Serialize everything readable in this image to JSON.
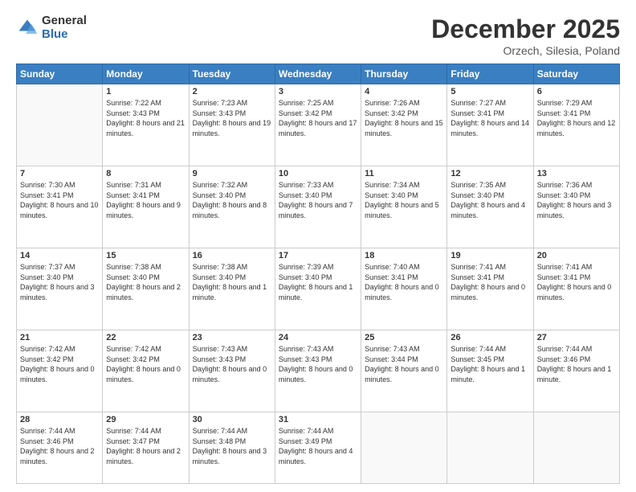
{
  "logo": {
    "general": "General",
    "blue": "Blue"
  },
  "header": {
    "month": "December 2025",
    "location": "Orzech, Silesia, Poland"
  },
  "weekdays": [
    "Sunday",
    "Monday",
    "Tuesday",
    "Wednesday",
    "Thursday",
    "Friday",
    "Saturday"
  ],
  "weeks": [
    [
      {
        "day": "",
        "sunrise": "",
        "sunset": "",
        "daylight": ""
      },
      {
        "day": "1",
        "sunrise": "Sunrise: 7:22 AM",
        "sunset": "Sunset: 3:43 PM",
        "daylight": "Daylight: 8 hours and 21 minutes."
      },
      {
        "day": "2",
        "sunrise": "Sunrise: 7:23 AM",
        "sunset": "Sunset: 3:43 PM",
        "daylight": "Daylight: 8 hours and 19 minutes."
      },
      {
        "day": "3",
        "sunrise": "Sunrise: 7:25 AM",
        "sunset": "Sunset: 3:42 PM",
        "daylight": "Daylight: 8 hours and 17 minutes."
      },
      {
        "day": "4",
        "sunrise": "Sunrise: 7:26 AM",
        "sunset": "Sunset: 3:42 PM",
        "daylight": "Daylight: 8 hours and 15 minutes."
      },
      {
        "day": "5",
        "sunrise": "Sunrise: 7:27 AM",
        "sunset": "Sunset: 3:41 PM",
        "daylight": "Daylight: 8 hours and 14 minutes."
      },
      {
        "day": "6",
        "sunrise": "Sunrise: 7:29 AM",
        "sunset": "Sunset: 3:41 PM",
        "daylight": "Daylight: 8 hours and 12 minutes."
      }
    ],
    [
      {
        "day": "7",
        "sunrise": "Sunrise: 7:30 AM",
        "sunset": "Sunset: 3:41 PM",
        "daylight": "Daylight: 8 hours and 10 minutes."
      },
      {
        "day": "8",
        "sunrise": "Sunrise: 7:31 AM",
        "sunset": "Sunset: 3:41 PM",
        "daylight": "Daylight: 8 hours and 9 minutes."
      },
      {
        "day": "9",
        "sunrise": "Sunrise: 7:32 AM",
        "sunset": "Sunset: 3:40 PM",
        "daylight": "Daylight: 8 hours and 8 minutes."
      },
      {
        "day": "10",
        "sunrise": "Sunrise: 7:33 AM",
        "sunset": "Sunset: 3:40 PM",
        "daylight": "Daylight: 8 hours and 7 minutes."
      },
      {
        "day": "11",
        "sunrise": "Sunrise: 7:34 AM",
        "sunset": "Sunset: 3:40 PM",
        "daylight": "Daylight: 8 hours and 5 minutes."
      },
      {
        "day": "12",
        "sunrise": "Sunrise: 7:35 AM",
        "sunset": "Sunset: 3:40 PM",
        "daylight": "Daylight: 8 hours and 4 minutes."
      },
      {
        "day": "13",
        "sunrise": "Sunrise: 7:36 AM",
        "sunset": "Sunset: 3:40 PM",
        "daylight": "Daylight: 8 hours and 3 minutes."
      }
    ],
    [
      {
        "day": "14",
        "sunrise": "Sunrise: 7:37 AM",
        "sunset": "Sunset: 3:40 PM",
        "daylight": "Daylight: 8 hours and 3 minutes."
      },
      {
        "day": "15",
        "sunrise": "Sunrise: 7:38 AM",
        "sunset": "Sunset: 3:40 PM",
        "daylight": "Daylight: 8 hours and 2 minutes."
      },
      {
        "day": "16",
        "sunrise": "Sunrise: 7:38 AM",
        "sunset": "Sunset: 3:40 PM",
        "daylight": "Daylight: 8 hours and 1 minute."
      },
      {
        "day": "17",
        "sunrise": "Sunrise: 7:39 AM",
        "sunset": "Sunset: 3:40 PM",
        "daylight": "Daylight: 8 hours and 1 minute."
      },
      {
        "day": "18",
        "sunrise": "Sunrise: 7:40 AM",
        "sunset": "Sunset: 3:41 PM",
        "daylight": "Daylight: 8 hours and 0 minutes."
      },
      {
        "day": "19",
        "sunrise": "Sunrise: 7:41 AM",
        "sunset": "Sunset: 3:41 PM",
        "daylight": "Daylight: 8 hours and 0 minutes."
      },
      {
        "day": "20",
        "sunrise": "Sunrise: 7:41 AM",
        "sunset": "Sunset: 3:41 PM",
        "daylight": "Daylight: 8 hours and 0 minutes."
      }
    ],
    [
      {
        "day": "21",
        "sunrise": "Sunrise: 7:42 AM",
        "sunset": "Sunset: 3:42 PM",
        "daylight": "Daylight: 8 hours and 0 minutes."
      },
      {
        "day": "22",
        "sunrise": "Sunrise: 7:42 AM",
        "sunset": "Sunset: 3:42 PM",
        "daylight": "Daylight: 8 hours and 0 minutes."
      },
      {
        "day": "23",
        "sunrise": "Sunrise: 7:43 AM",
        "sunset": "Sunset: 3:43 PM",
        "daylight": "Daylight: 8 hours and 0 minutes."
      },
      {
        "day": "24",
        "sunrise": "Sunrise: 7:43 AM",
        "sunset": "Sunset: 3:43 PM",
        "daylight": "Daylight: 8 hours and 0 minutes."
      },
      {
        "day": "25",
        "sunrise": "Sunrise: 7:43 AM",
        "sunset": "Sunset: 3:44 PM",
        "daylight": "Daylight: 8 hours and 0 minutes."
      },
      {
        "day": "26",
        "sunrise": "Sunrise: 7:44 AM",
        "sunset": "Sunset: 3:45 PM",
        "daylight": "Daylight: 8 hours and 1 minute."
      },
      {
        "day": "27",
        "sunrise": "Sunrise: 7:44 AM",
        "sunset": "Sunset: 3:46 PM",
        "daylight": "Daylight: 8 hours and 1 minute."
      }
    ],
    [
      {
        "day": "28",
        "sunrise": "Sunrise: 7:44 AM",
        "sunset": "Sunset: 3:46 PM",
        "daylight": "Daylight: 8 hours and 2 minutes."
      },
      {
        "day": "29",
        "sunrise": "Sunrise: 7:44 AM",
        "sunset": "Sunset: 3:47 PM",
        "daylight": "Daylight: 8 hours and 2 minutes."
      },
      {
        "day": "30",
        "sunrise": "Sunrise: 7:44 AM",
        "sunset": "Sunset: 3:48 PM",
        "daylight": "Daylight: 8 hours and 3 minutes."
      },
      {
        "day": "31",
        "sunrise": "Sunrise: 7:44 AM",
        "sunset": "Sunset: 3:49 PM",
        "daylight": "Daylight: 8 hours and 4 minutes."
      },
      {
        "day": "",
        "sunrise": "",
        "sunset": "",
        "daylight": ""
      },
      {
        "day": "",
        "sunrise": "",
        "sunset": "",
        "daylight": ""
      },
      {
        "day": "",
        "sunrise": "",
        "sunset": "",
        "daylight": ""
      }
    ]
  ]
}
